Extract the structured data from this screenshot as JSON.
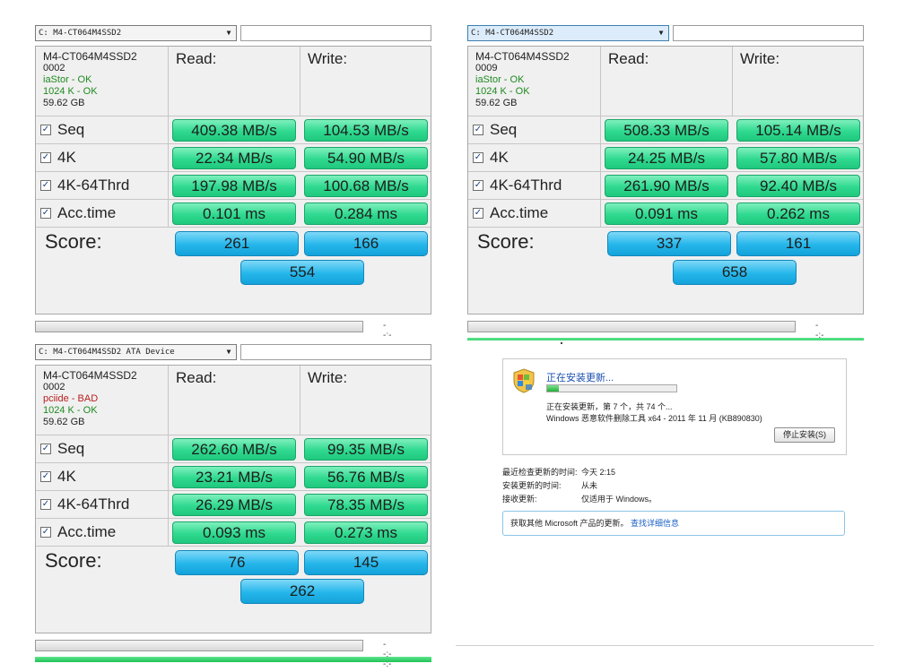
{
  "panels": [
    {
      "drive_select": "C: M4-CT064M4SSD2",
      "focused": false,
      "info": {
        "model": "M4-CT064M4SSD2",
        "firmware": "0002",
        "driver": "iaStor - OK",
        "driver_status": "ok",
        "align": "1024 K - OK",
        "size": "59.62 GB"
      },
      "read_header": "Read:",
      "write_header": "Write:",
      "rows": [
        {
          "label": "Seq",
          "read": "409.38 MB/s",
          "write": "104.53 MB/s"
        },
        {
          "label": "4K",
          "read": "22.34 MB/s",
          "write": "54.90 MB/s"
        },
        {
          "label": "4K-64Thrd",
          "read": "197.98 MB/s",
          "write": "100.68 MB/s"
        },
        {
          "label": "Acc.time",
          "read": "0.101 ms",
          "write": "0.284 ms"
        }
      ],
      "score_label": "Score:",
      "score_read": "261",
      "score_write": "166",
      "score_total": "554",
      "elapsed": "--:--:--"
    },
    {
      "drive_select": "C: M4-CT064M4SSD2",
      "focused": true,
      "info": {
        "model": "M4-CT064M4SSD2",
        "firmware": "0009",
        "driver": "iaStor - OK",
        "driver_status": "ok",
        "align": "1024 K - OK",
        "size": "59.62 GB"
      },
      "read_header": "Read:",
      "write_header": "Write:",
      "rows": [
        {
          "label": "Seq",
          "read": "508.33 MB/s",
          "write": "105.14 MB/s"
        },
        {
          "label": "4K",
          "read": "24.25 MB/s",
          "write": "57.80 MB/s"
        },
        {
          "label": "4K-64Thrd",
          "read": "261.90 MB/s",
          "write": "92.40 MB/s"
        },
        {
          "label": "Acc.time",
          "read": "0.091 ms",
          "write": "0.262 ms"
        }
      ],
      "score_label": "Score:",
      "score_read": "337",
      "score_write": "161",
      "score_total": "658",
      "elapsed": "--:--:--"
    },
    {
      "drive_select": "C: M4-CT064M4SSD2 ATA Device",
      "focused": false,
      "info": {
        "model": "M4-CT064M4SSD2",
        "firmware": "0002",
        "driver": "pciide - BAD",
        "driver_status": "bad",
        "align": "1024 K - OK",
        "size": "59.62 GB"
      },
      "read_header": "Read:",
      "write_header": "Write:",
      "rows": [
        {
          "label": "Seq",
          "read": "262.60 MB/s",
          "write": "99.35 MB/s"
        },
        {
          "label": "4K",
          "read": "23.21 MB/s",
          "write": "56.76 MB/s"
        },
        {
          "label": "4K-64Thrd",
          "read": "26.29 MB/s",
          "write": "78.35 MB/s"
        },
        {
          "label": "Acc.time",
          "read": "0.093 ms",
          "write": "0.273 ms"
        }
      ],
      "score_label": "Score:",
      "score_read": "76",
      "score_write": "145",
      "score_total": "262",
      "elapsed": "--:--:--"
    }
  ],
  "update": {
    "title": "正在安装更新...",
    "progress_fraction": 0.09,
    "status_line": "正在安装更新，第 7 个，共 74 个...",
    "item_line": "Windows 恶意软件删除工具 x64 - 2011 年 11 月 (KB890830)",
    "stop_button": "停止安装(S)",
    "last_check_label": "最近检查更新的时间:",
    "last_check_value": "今天 2:15",
    "installed_label": "安装更新的时间:",
    "installed_value": "从未",
    "receive_label": "接收更新:",
    "receive_value": "仅适用于 Windows。",
    "more_text": "获取其他 Microsoft 产品的更新。",
    "more_link": "查找详细信息",
    "icon": "windows-update-shield-icon"
  }
}
